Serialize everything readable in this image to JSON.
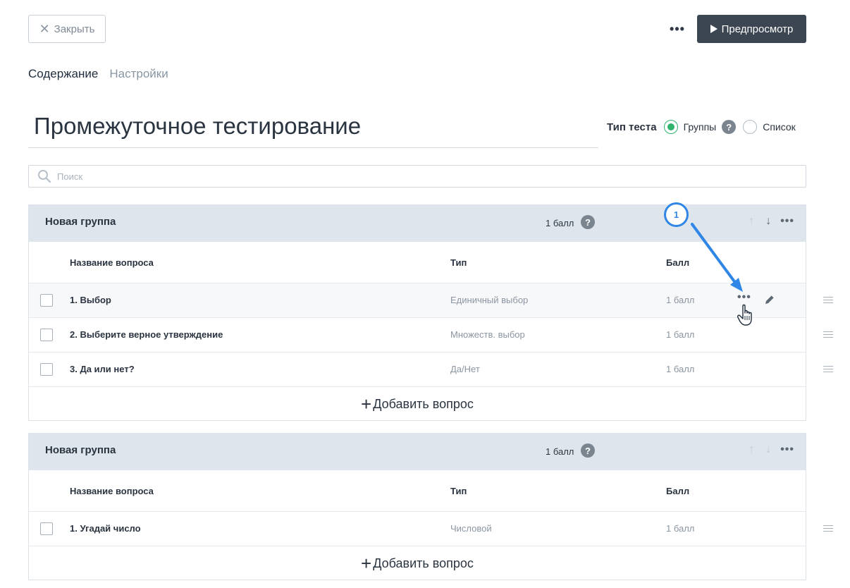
{
  "toolbar": {
    "close_label": "Закрыть",
    "more_icon": "more-horizontal-icon",
    "preview_label": "Предпросмотр"
  },
  "tabs": [
    {
      "label": "Содержание",
      "active": true
    },
    {
      "label": "Настройки",
      "active": false
    }
  ],
  "test": {
    "title": "Промежуточное тестирование",
    "type_label": "Тип теста",
    "type_options": [
      {
        "label": "Группы",
        "selected": true
      },
      {
        "label": "Список",
        "selected": false
      }
    ]
  },
  "search": {
    "placeholder": "Поиск"
  },
  "columns": {
    "name": "Название вопроса",
    "type": "Тип",
    "points": "Балл"
  },
  "groups": [
    {
      "title": "Новая группа",
      "points": "1 балл",
      "questions": [
        {
          "name": "1. Выбор",
          "type": "Единичный выбор",
          "points": "1 балл"
        },
        {
          "name": "2. Выберите верное утверждение",
          "type": "Множеств. выбор",
          "points": "1 балл"
        },
        {
          "name": "3. Да или нет?",
          "type": "Да/Нет",
          "points": "1 балл"
        }
      ],
      "add_label": "Добавить вопрос"
    },
    {
      "title": "Новая группа",
      "points": "1 балл",
      "questions": [
        {
          "name": "1. Угадай число",
          "type": "Числовой",
          "points": "1 балл"
        }
      ],
      "add_label": "Добавить вопрос"
    }
  ],
  "annotation": {
    "badge": "1"
  },
  "colors": {
    "accent_dark": "#3c4652",
    "radio_green": "#2fb56b",
    "annotation_blue": "#2f86e6",
    "group_header": "#dfe5ec"
  }
}
